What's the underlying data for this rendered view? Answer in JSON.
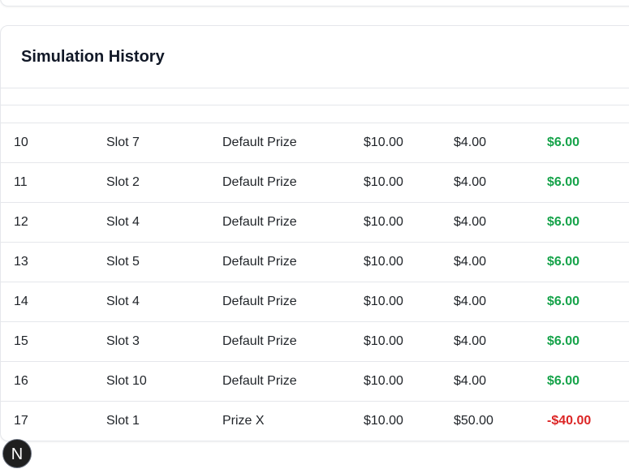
{
  "card": {
    "title": "Simulation History"
  },
  "rows": [
    {
      "id": "10",
      "slot": "Slot 7",
      "prize": "Default Prize",
      "cost": "$10.00",
      "value": "$4.00",
      "profit": "$6.00",
      "profit_sign": "pos"
    },
    {
      "id": "11",
      "slot": "Slot 2",
      "prize": "Default Prize",
      "cost": "$10.00",
      "value": "$4.00",
      "profit": "$6.00",
      "profit_sign": "pos"
    },
    {
      "id": "12",
      "slot": "Slot 4",
      "prize": "Default Prize",
      "cost": "$10.00",
      "value": "$4.00",
      "profit": "$6.00",
      "profit_sign": "pos"
    },
    {
      "id": "13",
      "slot": "Slot 5",
      "prize": "Default Prize",
      "cost": "$10.00",
      "value": "$4.00",
      "profit": "$6.00",
      "profit_sign": "pos"
    },
    {
      "id": "14",
      "slot": "Slot 4",
      "prize": "Default Prize",
      "cost": "$10.00",
      "value": "$4.00",
      "profit": "$6.00",
      "profit_sign": "pos"
    },
    {
      "id": "15",
      "slot": "Slot 3",
      "prize": "Default Prize",
      "cost": "$10.00",
      "value": "$4.00",
      "profit": "$6.00",
      "profit_sign": "pos"
    },
    {
      "id": "16",
      "slot": "Slot 10",
      "prize": "Default Prize",
      "cost": "$10.00",
      "value": "$4.00",
      "profit": "$6.00",
      "profit_sign": "pos"
    },
    {
      "id": "17",
      "slot": "Slot 1",
      "prize": "Prize X",
      "cost": "$10.00",
      "value": "$50.00",
      "profit": "-$40.00",
      "profit_sign": "neg"
    }
  ],
  "badge": {
    "letter": "N"
  },
  "colors": {
    "positive": "#16a34a",
    "negative": "#dc2626",
    "border": "#e5e7eb"
  }
}
